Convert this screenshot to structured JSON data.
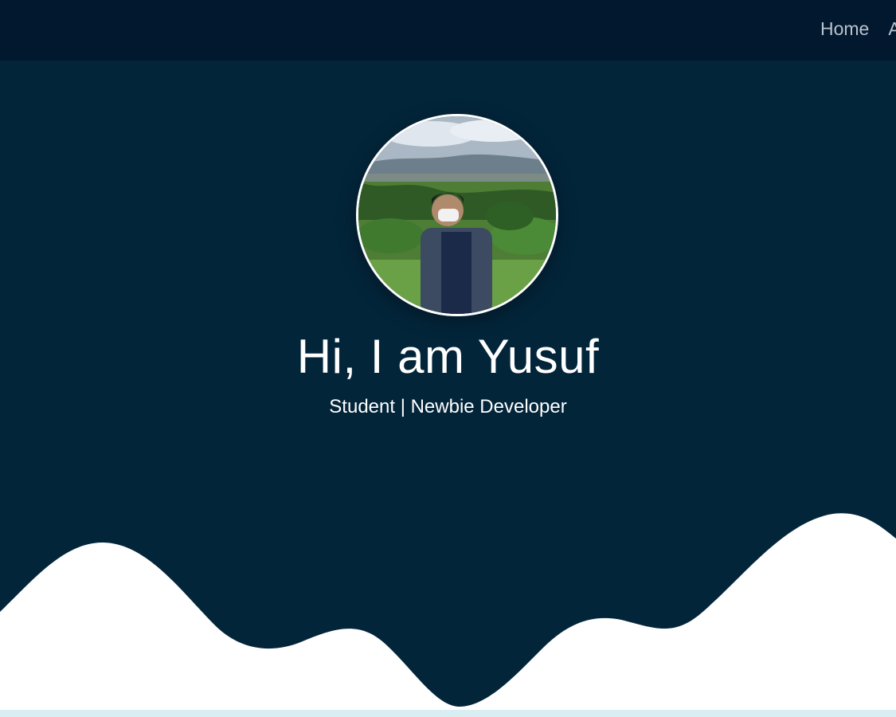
{
  "nav": {
    "items": [
      {
        "label": "Home"
      },
      {
        "label": "About"
      }
    ]
  },
  "hero": {
    "title": "Hi, I am Yusuf",
    "subtitle": "Student | Newbie Developer"
  },
  "colors": {
    "nav_bg": "#02182e",
    "hero_bg": "#03253a",
    "wave": "#ffffff",
    "text": "#ffffff",
    "nav_text": "#b9c3cd"
  }
}
